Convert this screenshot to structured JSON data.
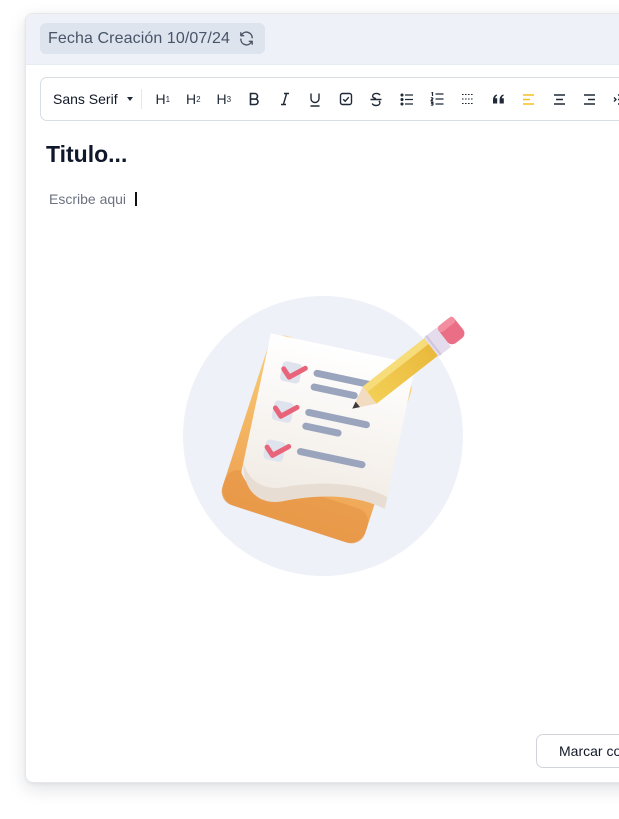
{
  "header": {
    "date_label": "Fecha Creación 10/07/24",
    "refresh_icon": "refresh-icon"
  },
  "toolbar": {
    "font": "Sans Serif",
    "buttons": [
      {
        "name": "heading-1-button",
        "label": "H",
        "sub": "1"
      },
      {
        "name": "heading-2-button",
        "label": "H",
        "sub": "2"
      },
      {
        "name": "heading-3-button",
        "label": "H",
        "sub": "3"
      },
      {
        "name": "bold-button",
        "icon": "bold-icon"
      },
      {
        "name": "italic-button",
        "icon": "italic-icon"
      },
      {
        "name": "underline-button",
        "icon": "underline-icon"
      },
      {
        "name": "checkbox-button",
        "icon": "checkbox-icon"
      },
      {
        "name": "strikethrough-button",
        "icon": "strikethrough-icon"
      },
      {
        "name": "bullet-list-button",
        "icon": "bullet-list-icon"
      },
      {
        "name": "ordered-list-button",
        "icon": "ordered-list-icon"
      },
      {
        "name": "divider-button",
        "icon": "divider-icon"
      },
      {
        "name": "quote-button",
        "icon": "quote-icon"
      },
      {
        "name": "align-left-button",
        "icon": "align-left-icon",
        "active": true
      },
      {
        "name": "align-center-button",
        "icon": "align-center-icon"
      },
      {
        "name": "align-right-button",
        "icon": "align-right-icon"
      },
      {
        "name": "indent-button",
        "icon": "indent-icon"
      }
    ],
    "active_color": "#f5c021"
  },
  "editor": {
    "title_placeholder": "Titulo...",
    "body_placeholder": "Escribe aqui"
  },
  "illustration": {
    "icon": "checklist-pencil-illustration"
  },
  "footer": {
    "mark_button_label": "Marcar co"
  }
}
